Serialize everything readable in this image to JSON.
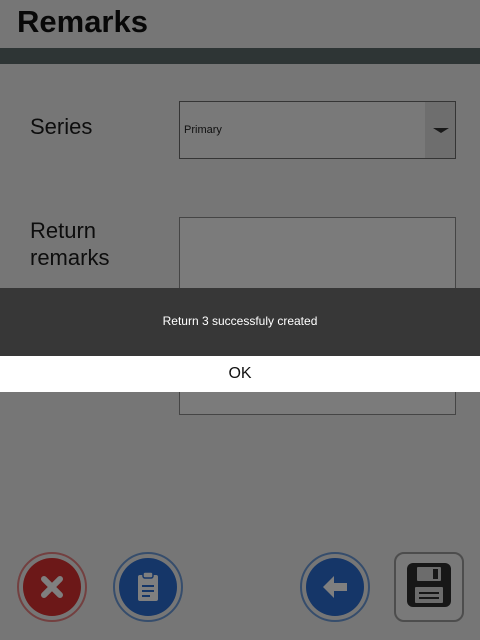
{
  "header": {
    "title": "Remarks"
  },
  "form": {
    "series_label": "Series",
    "series_value": "Primary",
    "remarks_label": "Return remarks",
    "remarks_value": ""
  },
  "toolbar": {
    "cancel_icon": "close-icon",
    "attach_icon": "clipboard-icon",
    "back_icon": "arrow-left-icon",
    "save_icon": "floppy-disk-icon"
  },
  "dialog": {
    "message": "Return 3 successfuly created",
    "ok_label": "OK"
  },
  "colors": {
    "accent_blue": "#2a6dd0",
    "danger_red": "#d83030",
    "header_bar": "#5d6a6b",
    "dialog_bg": "#373737"
  }
}
